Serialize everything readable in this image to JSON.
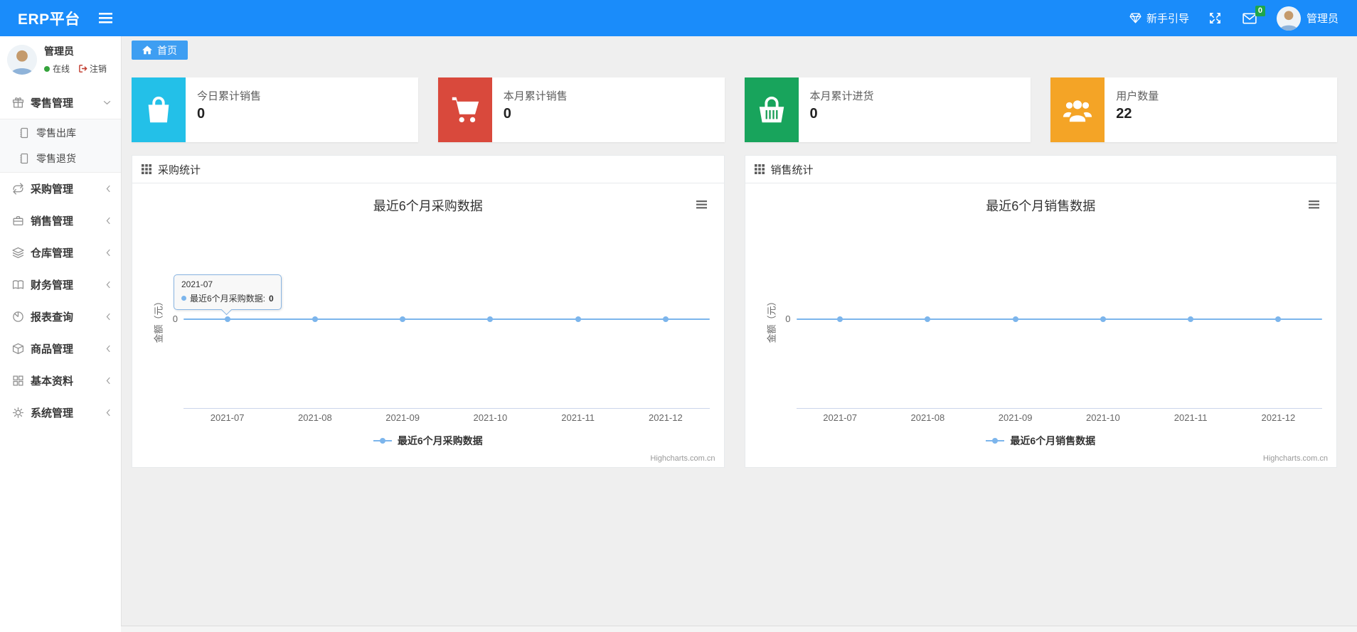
{
  "navbar": {
    "brand": "ERP平台",
    "guide_label": "新手引导",
    "message_badge": "0",
    "username": "管理员"
  },
  "sidebar": {
    "user": {
      "name": "管理员",
      "status_online": "在线",
      "logout_label": "注销"
    },
    "menu": [
      {
        "label": "零售管理",
        "icon": "gift-icon",
        "expanded": true,
        "children": [
          {
            "label": "零售出库",
            "icon": "journal-icon"
          },
          {
            "label": "零售退货",
            "icon": "journal-icon"
          }
        ]
      },
      {
        "label": "采购管理",
        "icon": "repeat-icon"
      },
      {
        "label": "销售管理",
        "icon": "briefcase-icon"
      },
      {
        "label": "仓库管理",
        "icon": "layers-icon"
      },
      {
        "label": "财务管理",
        "icon": "open-book-icon"
      },
      {
        "label": "报表查询",
        "icon": "pie-chart-icon"
      },
      {
        "label": "商品管理",
        "icon": "package-icon"
      },
      {
        "label": "基本资料",
        "icon": "grid-icon"
      },
      {
        "label": "系统管理",
        "icon": "gear-icon"
      }
    ]
  },
  "tabs": {
    "home": "首页"
  },
  "stats": [
    {
      "label": "今日累计销售",
      "value": "0",
      "color": "#23c0e8",
      "icon": "shopping-bag-icon"
    },
    {
      "label": "本月累计销售",
      "value": "0",
      "color": "#d9493c",
      "icon": "cart-icon"
    },
    {
      "label": "本月累计进货",
      "value": "0",
      "color": "#18a45c",
      "icon": "basket-icon"
    },
    {
      "label": "用户数量",
      "value": "22",
      "color": "#f4a426",
      "icon": "users-icon"
    }
  ],
  "chart_data": [
    {
      "type": "line",
      "panel_title": "采购统计",
      "title": "最近6个月采购数据",
      "categories": [
        "2021-07",
        "2021-08",
        "2021-09",
        "2021-10",
        "2021-11",
        "2021-12"
      ],
      "series": [
        {
          "name": "最近6个月采购数据",
          "values": [
            0,
            0,
            0,
            0,
            0,
            0
          ]
        }
      ],
      "ylabel": "金额（元）",
      "yticks": [
        "0"
      ],
      "line_color": "#7cb5ec",
      "grid": false,
      "legend_position": "bottom",
      "credits": "Highcharts.com.cn",
      "tooltip": {
        "header": "2021-07",
        "label": "最近6个月采购数据: ",
        "value": "0"
      }
    },
    {
      "type": "line",
      "panel_title": "销售统计",
      "title": "最近6个月销售数据",
      "categories": [
        "2021-07",
        "2021-08",
        "2021-09",
        "2021-10",
        "2021-11",
        "2021-12"
      ],
      "series": [
        {
          "name": "最近6个月销售数据",
          "values": [
            0,
            0,
            0,
            0,
            0,
            0
          ]
        }
      ],
      "ylabel": "金额（元）",
      "yticks": [
        "0"
      ],
      "line_color": "#7cb5ec",
      "grid": false,
      "legend_position": "bottom",
      "credits": "Highcharts.com.cn"
    }
  ],
  "colors": {
    "navbar": "#1a8cfa",
    "active_tab": "#3e9ef2",
    "message_badge": "#1fa64a",
    "chart_line": "#7cb5ec",
    "online_dot": "#35a33c"
  }
}
